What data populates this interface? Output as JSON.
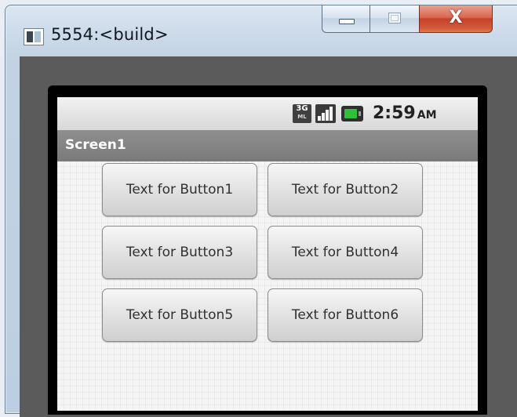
{
  "window": {
    "title": "5554:<build>",
    "controls": {
      "minimize": "–",
      "maximize": "□",
      "close": "X"
    }
  },
  "statusbar": {
    "network_badge_top": "3G",
    "network_badge_bottom": "ML",
    "signal_icon": "signal-bars-icon",
    "battery_icon": "battery-icon",
    "time": "2:59",
    "ampm": "AM",
    "colors": {
      "battery": "#2fbf3a"
    }
  },
  "screen": {
    "title": "Screen1",
    "buttons": [
      {
        "label": "Text for Button1"
      },
      {
        "label": "Text for Button2"
      },
      {
        "label": "Text for Button3"
      },
      {
        "label": "Text for Button4"
      },
      {
        "label": "Text for Button5"
      },
      {
        "label": "Text for Button6"
      }
    ]
  }
}
